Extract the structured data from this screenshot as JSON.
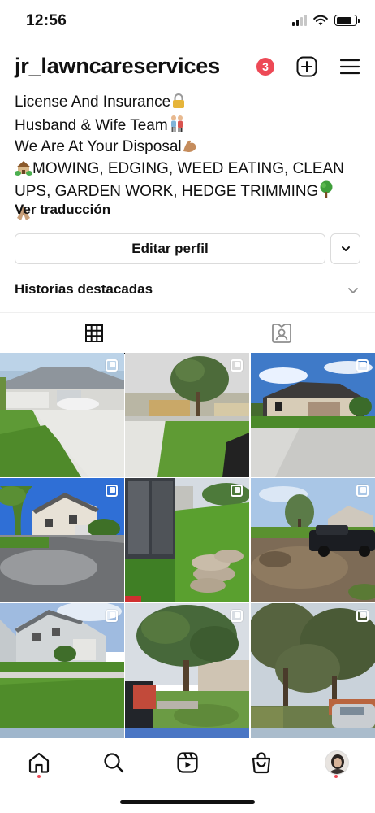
{
  "status_bar": {
    "time": "12:56"
  },
  "header": {
    "username": "jr_lawncareservices",
    "notification_count": "3"
  },
  "bio": {
    "line1": "License And Insurance",
    "line2": "Husband & Wife Team",
    "line3": "We Are At Your Disposal",
    "line4": "MOWING, EDGING, WEED EATING, CLEAN",
    "line5": "UPS, GARDEN WORK, HEDGE TRIMMING",
    "translate": "Ver traducción"
  },
  "actions": {
    "edit_profile": "Editar perfil"
  },
  "highlights": {
    "label": "Historias destacadas"
  },
  "tabs": [
    "grid-icon",
    "tagged-icon"
  ],
  "grid": {
    "columns": 3,
    "visible_rows": 3,
    "posts_visible": 9
  },
  "colors": {
    "accent_red": "#ed4956",
    "border": "#dbdbdb",
    "text": "#111111"
  },
  "nav": [
    "home-icon",
    "search-icon",
    "reels-icon",
    "shop-icon",
    "profile-avatar"
  ]
}
